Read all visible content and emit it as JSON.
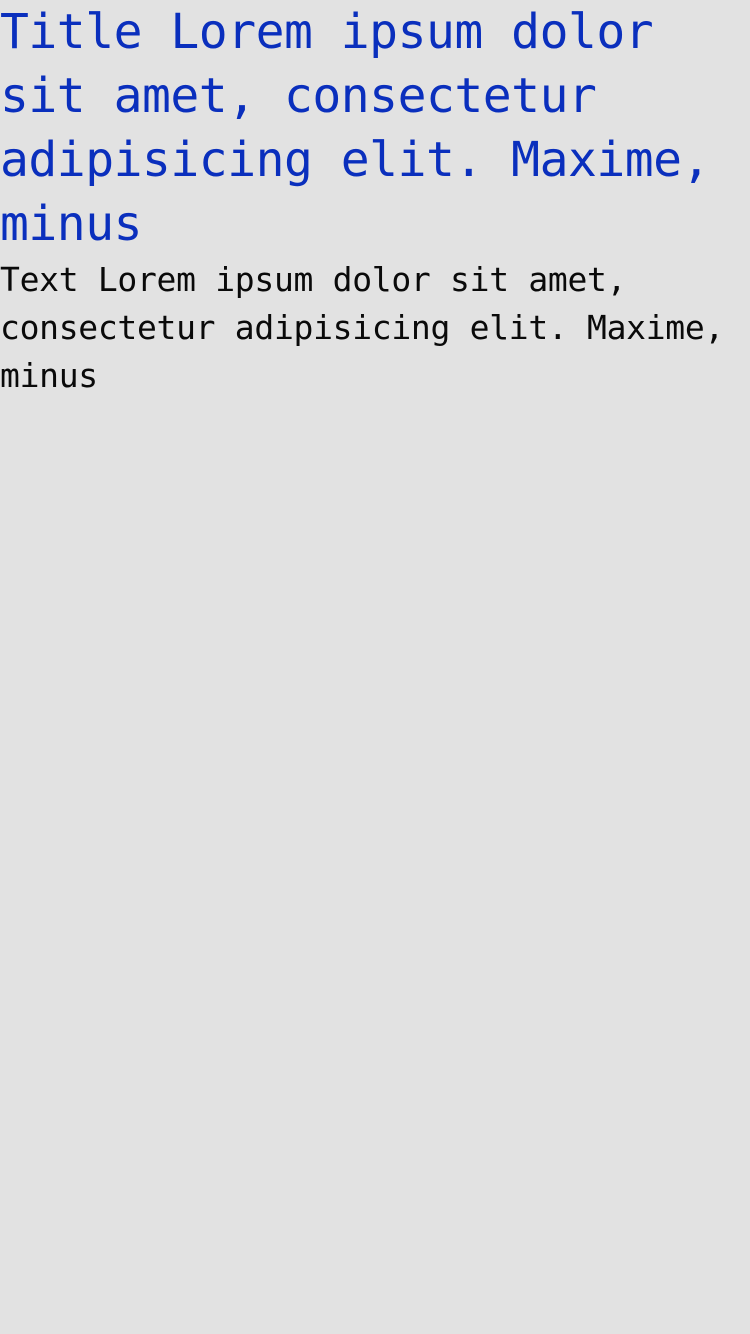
{
  "content": {
    "title": "Title Lorem ipsum dolor sit amet, consectetur adipisicing elit. Maxime, minus",
    "text": "Text Lorem ipsum dolor sit amet, consectetur adipisicing elit. Maxime, minus"
  },
  "colors": {
    "background": "#e2e2e2",
    "title": "#0a2fbd",
    "text": "#0a0a0a"
  }
}
